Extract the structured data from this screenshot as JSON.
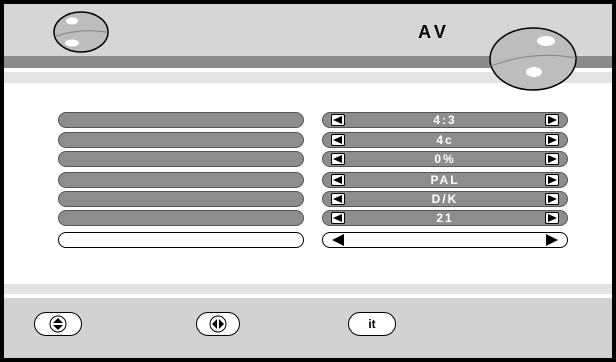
{
  "window": {
    "title": "AV"
  },
  "menu": {
    "rows": [
      {
        "label": "",
        "value": "4:3"
      },
      {
        "label": "",
        "value": "4c"
      },
      {
        "label": "",
        "value": "0%"
      },
      {
        "label": "",
        "value": "PAL"
      },
      {
        "label": "",
        "value": "D/K"
      },
      {
        "label": "",
        "value": "21"
      },
      {
        "label": "",
        "value": ""
      }
    ]
  },
  "footer": {
    "buttons": [
      {
        "name": "up-down",
        "icon": "up-down-arrows-icon"
      },
      {
        "name": "left-right",
        "icon": "left-right-arrows-icon"
      },
      {
        "name": "it",
        "label": "it"
      }
    ]
  },
  "colors": {
    "header_bg": "#d6d6d6",
    "band_dark": "#8b8b8b",
    "row_fill": "#8d8d8d",
    "footer_bg": "#d2d2d2"
  }
}
